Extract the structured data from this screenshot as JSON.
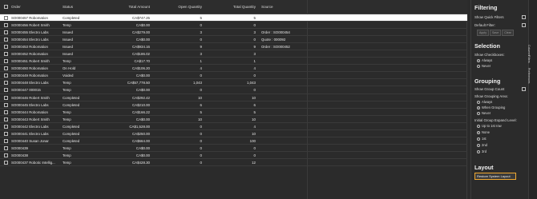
{
  "columns": [
    "Order",
    "Status",
    "Total Amount",
    "Open Quantity",
    "Total Quantity",
    "Source"
  ],
  "rows": [
    {
      "order": "SO000457 Robomation",
      "status": "Completed",
      "amount": "CA$747.25",
      "open": "5",
      "total": "5",
      "source": ""
    },
    {
      "order": "SO000456 Robert Smith",
      "status": "Temp",
      "amount": "CA$0.00",
      "open": "0",
      "total": "0",
      "source": ""
    },
    {
      "order": "SO000455 Electro Labs",
      "status": "Issued",
      "amount": "CA$279.00",
      "open": "3",
      "total": "3",
      "source": "Order : SO000454"
    },
    {
      "order": "SO000454 Electro Labs",
      "status": "Issued",
      "amount": "CA$0.00",
      "open": "0",
      "total": "0",
      "source": "Quote : 000092"
    },
    {
      "order": "SO000453 Robomation",
      "status": "Issued",
      "amount": "CA$934.16",
      "open": "9",
      "total": "9",
      "source": "Order : SO000452"
    },
    {
      "order": "SO000452 Robomation",
      "status": "Issued",
      "amount": "CA$186.02",
      "open": "3",
      "total": "3",
      "source": ""
    },
    {
      "order": "SO000451 Robert Smith",
      "status": "Temp",
      "amount": "CA$17.70",
      "open": "1",
      "total": "1",
      "source": ""
    },
    {
      "order": "SO000450 Robomation",
      "status": "On Hold",
      "amount": "CA$106.20",
      "open": "4",
      "total": "4",
      "source": ""
    },
    {
      "order": "SO000449 Robomation",
      "status": "Voided",
      "amount": "CA$0.00",
      "open": "0",
      "total": "0",
      "source": ""
    },
    {
      "order": "SO000448 Electro Labs",
      "status": "Temp",
      "amount": "CA$57,778.50",
      "open": "1,043",
      "total": "1,043",
      "source": ""
    },
    {
      "order": "SO000447 000015",
      "status": "Temp",
      "amount": "CA$0.00",
      "open": "0",
      "total": "0",
      "source": ""
    },
    {
      "order": "SO000446 Robert Smith",
      "status": "Completed",
      "amount": "CA$292.42",
      "open": "10",
      "total": "10",
      "source": ""
    },
    {
      "order": "SO000445 Electro Labs",
      "status": "Completed",
      "amount": "CA$210.00",
      "open": "6",
      "total": "6",
      "source": ""
    },
    {
      "order": "SO000444 Robomation",
      "status": "Temp",
      "amount": "CA$166.22",
      "open": "5",
      "total": "5",
      "source": ""
    },
    {
      "order": "SO000443 Robert Smith",
      "status": "Temp",
      "amount": "CA$0.00",
      "open": "10",
      "total": "10",
      "source": ""
    },
    {
      "order": "SO000442 Electro Labs",
      "status": "Completed",
      "amount": "CA$1,528.00",
      "open": "0",
      "total": "4",
      "source": ""
    },
    {
      "order": "SO000441 Electro Labs",
      "status": "Completed",
      "amount": "CA$250.00",
      "open": "0",
      "total": "10",
      "source": ""
    },
    {
      "order": "SO000440 Susan Jonar",
      "status": "Completed",
      "amount": "CA$664.00",
      "open": "0",
      "total": "100",
      "source": ""
    },
    {
      "order": "SO000439",
      "status": "Temp",
      "amount": "CA$0.00",
      "open": "0",
      "total": "0",
      "source": ""
    },
    {
      "order": "SO000438",
      "status": "Temp",
      "amount": "CA$0.00",
      "open": "0",
      "total": "0",
      "source": ""
    },
    {
      "order": "SO000437 Robotic Intellig...",
      "status": "Temp",
      "amount": "CA$428.30",
      "open": "0",
      "total": "12",
      "source": ""
    }
  ],
  "selected_row": 0,
  "side_tabs": [
    "Columns",
    "Filters",
    "Preferences"
  ],
  "panel": {
    "filtering": {
      "title": "Filtering",
      "show_quick_filters": "Show Quick Filters",
      "default_filter": "Default Filter:",
      "buttons": [
        "Apply",
        "Save",
        "Clear"
      ]
    },
    "selection": {
      "title": "Selection",
      "show_checkboxes": "Show Checkboxes:",
      "options": [
        "Always",
        "Never"
      ],
      "selected": 0
    },
    "grouping": {
      "title": "Grouping",
      "show_group_count": "Show Group Count",
      "show_grouping_area": "Show Grouping Area:",
      "area_options": [
        "Always",
        "When Grouping",
        "Never"
      ],
      "area_selected": 1,
      "expand_level": "Initial Group Expand Level:",
      "level_options": [
        "Up to 1st row",
        "None",
        "1st",
        "2nd",
        "3rd"
      ],
      "level_selected": 1
    },
    "layout": {
      "title": "Layout",
      "restore_label": "Restore System Layout"
    }
  }
}
